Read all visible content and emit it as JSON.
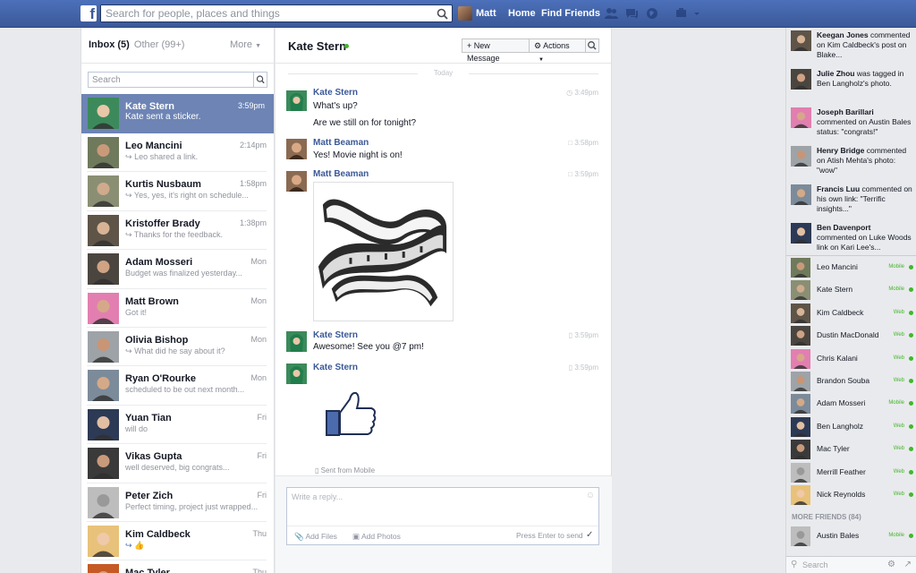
{
  "colors": {
    "brand": "#3b5998",
    "selected": "#6d84b4",
    "online": "#42b72a"
  },
  "topbar": {
    "search_placeholder": "Search for people, places and things",
    "user_name": "Matt",
    "home": "Home",
    "find_friends": "Find Friends"
  },
  "inbox": {
    "title": "Inbox (5)",
    "other": "Other (99+)",
    "more": "More",
    "search_placeholder": "Search",
    "threads": [
      {
        "name": "Kate Stern",
        "time": "3:59pm",
        "preview": "Kate sent a sticker."
      },
      {
        "name": "Leo Mancini",
        "time": "2:14pm",
        "preview": "Leo shared a link."
      },
      {
        "name": "Kurtis Nusbaum",
        "time": "1:58pm",
        "preview": "Yes, yes, it's right on schedule..."
      },
      {
        "name": "Kristoffer Brady",
        "time": "1:38pm",
        "preview": "Thanks for the feedback."
      },
      {
        "name": "Adam Mosseri",
        "time": "Mon",
        "preview": "Budget was finalized yesterday..."
      },
      {
        "name": "Matt Brown",
        "time": "Mon",
        "preview": "Got it!"
      },
      {
        "name": "Olivia Bishop",
        "time": "Mon",
        "preview": "What did he say about it?"
      },
      {
        "name": "Ryan O'Rourke",
        "time": "Mon",
        "preview": "scheduled to be out next month..."
      },
      {
        "name": "Yuan Tian",
        "time": "Fri",
        "preview": "will do"
      },
      {
        "name": "Vikas Gupta",
        "time": "Fri",
        "preview": "well deserved, big congrats..."
      },
      {
        "name": "Peter Zich",
        "time": "Fri",
        "preview": "Perfect timing, project just wrapped..."
      },
      {
        "name": "Kim Caldbeck",
        "time": "Thu",
        "preview": ""
      },
      {
        "name": "Mac Tyler",
        "time": "Thu",
        "preview": ""
      }
    ]
  },
  "conversation": {
    "name": "Kate Stern",
    "new_message": "New Message",
    "actions": "Actions",
    "today": "Today",
    "messages": [
      {
        "sender": "Kate Stern",
        "time": "3:49pm",
        "lines": [
          "What's up?",
          "Are we still on for tonight?"
        ]
      },
      {
        "sender": "Matt Beaman",
        "time": "3:58pm",
        "lines": [
          "Yes! Movie night is on!"
        ]
      },
      {
        "sender": "Matt Beaman",
        "time": "3:59pm",
        "lines": []
      },
      {
        "sender": "Kate Stern",
        "time": "3:59pm",
        "lines": [
          "Awesome! See you @7 pm!"
        ]
      },
      {
        "sender": "Kate Stern",
        "time": "3:59pm",
        "lines": []
      }
    ],
    "sent_from": "Sent from Mobile",
    "reply_placeholder": "Write a reply...",
    "add_files": "Add Files",
    "add_photos": "Add Photos",
    "press_enter": "Press Enter to send"
  },
  "ticker": [
    {
      "name": "Keegan Jones",
      "text": " commented on Kim Caldbeck's post on Blake..."
    },
    {
      "name": "Julie Zhou",
      "text": " was tagged in Ben Langholz's photo."
    },
    {
      "name": "Joseph Barillari",
      "text": " commented on Austin Bales status: \"congrats!\""
    },
    {
      "name": "Henry Bridge",
      "text": " commented on Atish Mehta's photo: \"wow\""
    },
    {
      "name": "Francis Luu",
      "text": " commented on his own link: \"Terrific insights...\""
    },
    {
      "name": "Ben Davenport",
      "text": " commented on Luke Woods link on Kari Lee's..."
    }
  ],
  "chat": {
    "friends": [
      {
        "name": "Leo Mancini",
        "status": "Mobile"
      },
      {
        "name": "Kate Stern",
        "status": "Mobile"
      },
      {
        "name": "Kim Caldbeck",
        "status": "Web"
      },
      {
        "name": "Dustin MacDonald",
        "status": "Web"
      },
      {
        "name": "Chris Kalani",
        "status": "Web"
      },
      {
        "name": "Brandon Souba",
        "status": "Web"
      },
      {
        "name": "Adam Mosseri",
        "status": "Mobile"
      },
      {
        "name": "Ben Langholz",
        "status": "Web"
      },
      {
        "name": "Mac Tyler",
        "status": "Web"
      },
      {
        "name": "Merrill Feather",
        "status": "Web"
      },
      {
        "name": "Nick Reynolds",
        "status": "Web"
      }
    ],
    "more_friends": "MORE FRIENDS (84)",
    "more_list": [
      {
        "name": "Austin Bales",
        "status": "Mobile"
      }
    ],
    "search_placeholder": "Search"
  }
}
